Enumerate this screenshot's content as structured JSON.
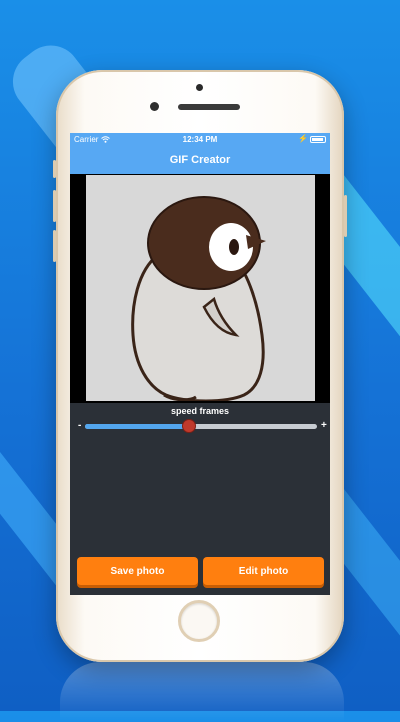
{
  "status_bar": {
    "carrier": "Carrier",
    "wifi_icon": "wifi-icon",
    "time": "12:34 PM",
    "charging_icon": "bolt-icon",
    "battery_icon": "battery-icon"
  },
  "nav": {
    "title": "GIF Creator"
  },
  "preview": {
    "image": "penguin-illustration"
  },
  "speed": {
    "label": "speed frames",
    "min_label": "-",
    "max_label": "+",
    "value_fraction": 0.45
  },
  "buttons": {
    "save_label": "Save photo",
    "edit_label": "Edit photo"
  },
  "colors": {
    "accent": "#57a8f3",
    "button": "#ff7f0f",
    "thumb": "#c0392b",
    "screen_bg": "#2b3037"
  }
}
